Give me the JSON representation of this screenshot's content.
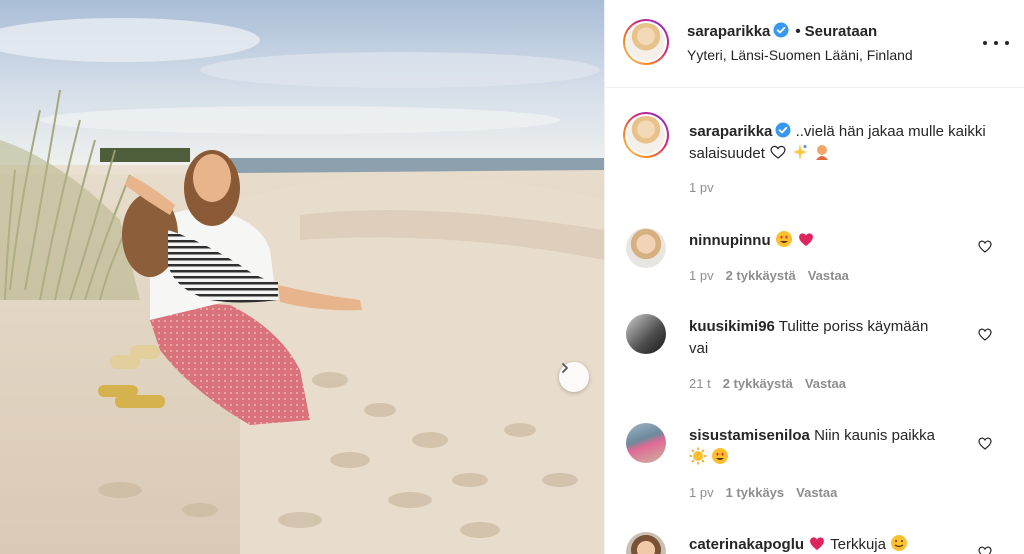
{
  "header": {
    "username": "saraparikka",
    "follow_status": "Seurataan",
    "location": "Yyteri, Länsi-Suomen Lääni, Finland"
  },
  "caption": {
    "username": "saraparikka",
    "text": "..vielä hän jakaa mulle kaikki salaisuudet",
    "time": "1 pv"
  },
  "comments": [
    {
      "username": "ninnupinnu",
      "text": "",
      "time": "1 pv",
      "likes": "2 tykkäystä",
      "reply": "Vastaa"
    },
    {
      "username": "kuusikimi96",
      "text": "Tulitte poriss käymään vai",
      "time": "21 t",
      "likes": "2 tykkäystä",
      "reply": "Vastaa"
    },
    {
      "username": "sisustamiseniloa",
      "text": "Niin kaunis paikka",
      "time": "1 pv",
      "likes": "1 tykkäys",
      "reply": "Vastaa"
    },
    {
      "username": "caterinakapoglu",
      "text": "Terkkuja",
      "time": "",
      "likes": "",
      "reply": ""
    }
  ],
  "colors": {
    "verified": "#3897f0",
    "meta": "#8e8e8e",
    "text": "#262626",
    "heart": "#e0245e"
  },
  "icons": [
    "verified-badge-icon",
    "more-options-icon",
    "heart-outline-icon",
    "chevron-right-icon"
  ]
}
